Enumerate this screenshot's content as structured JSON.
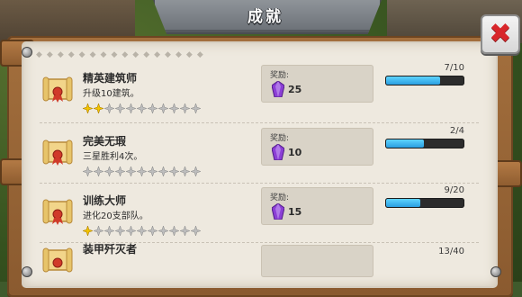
{
  "window": {
    "title": "成就"
  },
  "close": {
    "label": "✖"
  },
  "achievements": [
    {
      "name": "精英建筑师",
      "desc": "升级10建筑。",
      "reward_label": "奖励:",
      "reward": "25",
      "progress_text": "7/10",
      "progress": 0.7,
      "gold_stars": 2,
      "total_stars": 11
    },
    {
      "name": "完美无瑕",
      "desc": "三星胜利4次。",
      "reward_label": "奖励:",
      "reward": "10",
      "progress_text": "2/4",
      "progress": 0.5,
      "gold_stars": 0,
      "total_stars": 11
    },
    {
      "name": "训练大师",
      "desc": "进化20支部队。",
      "reward_label": "奖励:",
      "reward": "15",
      "progress_text": "9/20",
      "progress": 0.45,
      "gold_stars": 1,
      "total_stars": 11
    },
    {
      "name": "装甲歼灭者",
      "desc": "",
      "reward_label": "",
      "reward": "",
      "progress_text": "13/40",
      "progress": 0.325,
      "gold_stars": 0,
      "total_stars": 11
    }
  ],
  "colors": {
    "star_gold": "#f3c400",
    "star_empty": "#bdbdbd",
    "gem": "#8c3fd6",
    "progress": "#36b6f5",
    "close_x": "#d8262b"
  },
  "icons": {
    "scroll": "scroll-icon",
    "gem": "gem-icon",
    "star": "star-icon",
    "close": "close-icon"
  }
}
